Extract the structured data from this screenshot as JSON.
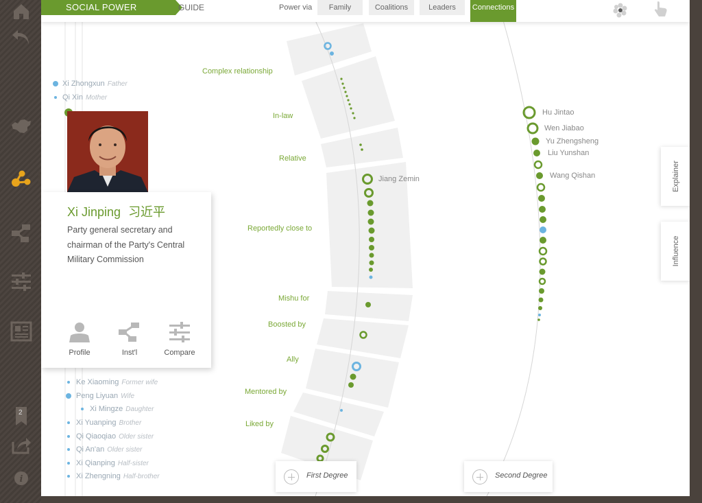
{
  "brand": "SOCIAL POWER",
  "guide": "GUIDE",
  "power_via": "Power via",
  "tabs": [
    "Family",
    "Coalitions",
    "Leaders",
    "Connections"
  ],
  "active_tab": "Connections",
  "colors": {
    "accent": "#6a9a2e",
    "blue_node": "#6cb4e0",
    "rail": "#4a423c"
  },
  "rail": {
    "badge_count": "2"
  },
  "relations": [
    "Complex relationship",
    "In-law",
    "Relative",
    "Reportedly close to",
    "Mishu for",
    "Boosted by",
    "Ally",
    "Mentored by",
    "Liked by"
  ],
  "first_degree_names": {
    "jiang": "Jiang Zemin"
  },
  "second_degree_names": [
    "Hu Jintao",
    "Wen Jiabao",
    "Yu Zhengsheng",
    "Liu Yunshan",
    "Wang Qishan"
  ],
  "family_top": [
    {
      "name": "Xi Zhongxun",
      "role": "Father"
    },
    {
      "name": "Qi Xin",
      "role": "Mother"
    }
  ],
  "family_bottom": [
    {
      "name": "Ke Xiaoming",
      "role": "Former wife"
    },
    {
      "name": "Peng Liyuan",
      "role": "Wife"
    },
    {
      "name": "Xi Mingze",
      "role": "Daughter"
    },
    {
      "name": "Xi Yuanping",
      "role": "Brother"
    },
    {
      "name": "Qi Qiaoqiao",
      "role": "Older sister"
    },
    {
      "name": "Qi An'an",
      "role": "Older sister"
    },
    {
      "name": "Xi Qianping",
      "role": "Half-sister"
    },
    {
      "name": "Xi Zhengning",
      "role": "Half-brother"
    }
  ],
  "profile": {
    "name": "Xi Jinping",
    "name_cn": "习近平",
    "description": "Party general secretary and chairman of the Party's Central Military Commission",
    "actions": [
      "Profile",
      "Inst'l",
      "Compare"
    ]
  },
  "side_tabs": [
    "Explainer",
    "Influence"
  ],
  "degrees": [
    "First Degree",
    "Second Degree"
  ]
}
